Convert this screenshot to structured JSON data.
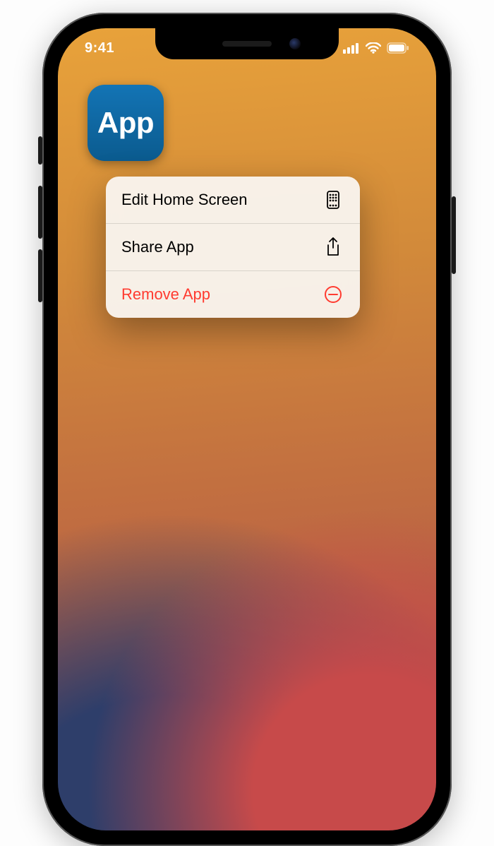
{
  "status": {
    "time": "9:41"
  },
  "app": {
    "label": "App"
  },
  "menu": {
    "items": [
      {
        "label": "Edit Home Screen",
        "icon": "home-screen-icon",
        "destructive": false
      },
      {
        "label": "Share App",
        "icon": "share-icon",
        "destructive": false
      },
      {
        "label": "Remove App",
        "icon": "remove-icon",
        "destructive": true
      }
    ]
  }
}
